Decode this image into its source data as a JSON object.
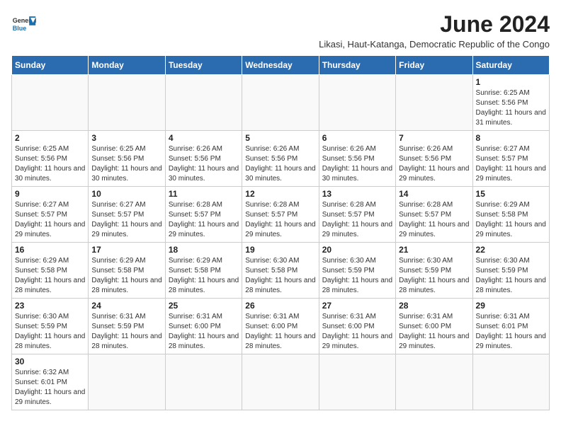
{
  "header": {
    "logo_general": "General",
    "logo_blue": "Blue",
    "month_year": "June 2024",
    "location": "Likasi, Haut-Katanga, Democratic Republic of the Congo"
  },
  "weekdays": [
    "Sunday",
    "Monday",
    "Tuesday",
    "Wednesday",
    "Thursday",
    "Friday",
    "Saturday"
  ],
  "weeks": [
    [
      {
        "day": "",
        "sunrise": "",
        "sunset": "",
        "daylight": ""
      },
      {
        "day": "",
        "sunrise": "",
        "sunset": "",
        "daylight": ""
      },
      {
        "day": "",
        "sunrise": "",
        "sunset": "",
        "daylight": ""
      },
      {
        "day": "",
        "sunrise": "",
        "sunset": "",
        "daylight": ""
      },
      {
        "day": "",
        "sunrise": "",
        "sunset": "",
        "daylight": ""
      },
      {
        "day": "",
        "sunrise": "",
        "sunset": "",
        "daylight": ""
      },
      {
        "day": "1",
        "sunrise": "Sunrise: 6:25 AM",
        "sunset": "Sunset: 5:56 PM",
        "daylight": "Daylight: 11 hours and 31 minutes."
      }
    ],
    [
      {
        "day": "2",
        "sunrise": "Sunrise: 6:25 AM",
        "sunset": "Sunset: 5:56 PM",
        "daylight": "Daylight: 11 hours and 30 minutes."
      },
      {
        "day": "3",
        "sunrise": "Sunrise: 6:25 AM",
        "sunset": "Sunset: 5:56 PM",
        "daylight": "Daylight: 11 hours and 30 minutes."
      },
      {
        "day": "4",
        "sunrise": "Sunrise: 6:26 AM",
        "sunset": "Sunset: 5:56 PM",
        "daylight": "Daylight: 11 hours and 30 minutes."
      },
      {
        "day": "5",
        "sunrise": "Sunrise: 6:26 AM",
        "sunset": "Sunset: 5:56 PM",
        "daylight": "Daylight: 11 hours and 30 minutes."
      },
      {
        "day": "6",
        "sunrise": "Sunrise: 6:26 AM",
        "sunset": "Sunset: 5:56 PM",
        "daylight": "Daylight: 11 hours and 30 minutes."
      },
      {
        "day": "7",
        "sunrise": "Sunrise: 6:26 AM",
        "sunset": "Sunset: 5:56 PM",
        "daylight": "Daylight: 11 hours and 29 minutes."
      },
      {
        "day": "8",
        "sunrise": "Sunrise: 6:27 AM",
        "sunset": "Sunset: 5:57 PM",
        "daylight": "Daylight: 11 hours and 29 minutes."
      }
    ],
    [
      {
        "day": "9",
        "sunrise": "Sunrise: 6:27 AM",
        "sunset": "Sunset: 5:57 PM",
        "daylight": "Daylight: 11 hours and 29 minutes."
      },
      {
        "day": "10",
        "sunrise": "Sunrise: 6:27 AM",
        "sunset": "Sunset: 5:57 PM",
        "daylight": "Daylight: 11 hours and 29 minutes."
      },
      {
        "day": "11",
        "sunrise": "Sunrise: 6:28 AM",
        "sunset": "Sunset: 5:57 PM",
        "daylight": "Daylight: 11 hours and 29 minutes."
      },
      {
        "day": "12",
        "sunrise": "Sunrise: 6:28 AM",
        "sunset": "Sunset: 5:57 PM",
        "daylight": "Daylight: 11 hours and 29 minutes."
      },
      {
        "day": "13",
        "sunrise": "Sunrise: 6:28 AM",
        "sunset": "Sunset: 5:57 PM",
        "daylight": "Daylight: 11 hours and 29 minutes."
      },
      {
        "day": "14",
        "sunrise": "Sunrise: 6:28 AM",
        "sunset": "Sunset: 5:57 PM",
        "daylight": "Daylight: 11 hours and 29 minutes."
      },
      {
        "day": "15",
        "sunrise": "Sunrise: 6:29 AM",
        "sunset": "Sunset: 5:58 PM",
        "daylight": "Daylight: 11 hours and 29 minutes."
      }
    ],
    [
      {
        "day": "16",
        "sunrise": "Sunrise: 6:29 AM",
        "sunset": "Sunset: 5:58 PM",
        "daylight": "Daylight: 11 hours and 28 minutes."
      },
      {
        "day": "17",
        "sunrise": "Sunrise: 6:29 AM",
        "sunset": "Sunset: 5:58 PM",
        "daylight": "Daylight: 11 hours and 28 minutes."
      },
      {
        "day": "18",
        "sunrise": "Sunrise: 6:29 AM",
        "sunset": "Sunset: 5:58 PM",
        "daylight": "Daylight: 11 hours and 28 minutes."
      },
      {
        "day": "19",
        "sunrise": "Sunrise: 6:30 AM",
        "sunset": "Sunset: 5:58 PM",
        "daylight": "Daylight: 11 hours and 28 minutes."
      },
      {
        "day": "20",
        "sunrise": "Sunrise: 6:30 AM",
        "sunset": "Sunset: 5:59 PM",
        "daylight": "Daylight: 11 hours and 28 minutes."
      },
      {
        "day": "21",
        "sunrise": "Sunrise: 6:30 AM",
        "sunset": "Sunset: 5:59 PM",
        "daylight": "Daylight: 11 hours and 28 minutes."
      },
      {
        "day": "22",
        "sunrise": "Sunrise: 6:30 AM",
        "sunset": "Sunset: 5:59 PM",
        "daylight": "Daylight: 11 hours and 28 minutes."
      }
    ],
    [
      {
        "day": "23",
        "sunrise": "Sunrise: 6:30 AM",
        "sunset": "Sunset: 5:59 PM",
        "daylight": "Daylight: 11 hours and 28 minutes."
      },
      {
        "day": "24",
        "sunrise": "Sunrise: 6:31 AM",
        "sunset": "Sunset: 5:59 PM",
        "daylight": "Daylight: 11 hours and 28 minutes."
      },
      {
        "day": "25",
        "sunrise": "Sunrise: 6:31 AM",
        "sunset": "Sunset: 6:00 PM",
        "daylight": "Daylight: 11 hours and 28 minutes."
      },
      {
        "day": "26",
        "sunrise": "Sunrise: 6:31 AM",
        "sunset": "Sunset: 6:00 PM",
        "daylight": "Daylight: 11 hours and 28 minutes."
      },
      {
        "day": "27",
        "sunrise": "Sunrise: 6:31 AM",
        "sunset": "Sunset: 6:00 PM",
        "daylight": "Daylight: 11 hours and 29 minutes."
      },
      {
        "day": "28",
        "sunrise": "Sunrise: 6:31 AM",
        "sunset": "Sunset: 6:00 PM",
        "daylight": "Daylight: 11 hours and 29 minutes."
      },
      {
        "day": "29",
        "sunrise": "Sunrise: 6:31 AM",
        "sunset": "Sunset: 6:01 PM",
        "daylight": "Daylight: 11 hours and 29 minutes."
      }
    ],
    [
      {
        "day": "30",
        "sunrise": "Sunrise: 6:32 AM",
        "sunset": "Sunset: 6:01 PM",
        "daylight": "Daylight: 11 hours and 29 minutes."
      },
      {
        "day": "",
        "sunrise": "",
        "sunset": "",
        "daylight": ""
      },
      {
        "day": "",
        "sunrise": "",
        "sunset": "",
        "daylight": ""
      },
      {
        "day": "",
        "sunrise": "",
        "sunset": "",
        "daylight": ""
      },
      {
        "day": "",
        "sunrise": "",
        "sunset": "",
        "daylight": ""
      },
      {
        "day": "",
        "sunrise": "",
        "sunset": "",
        "daylight": ""
      },
      {
        "day": "",
        "sunrise": "",
        "sunset": "",
        "daylight": ""
      }
    ]
  ]
}
